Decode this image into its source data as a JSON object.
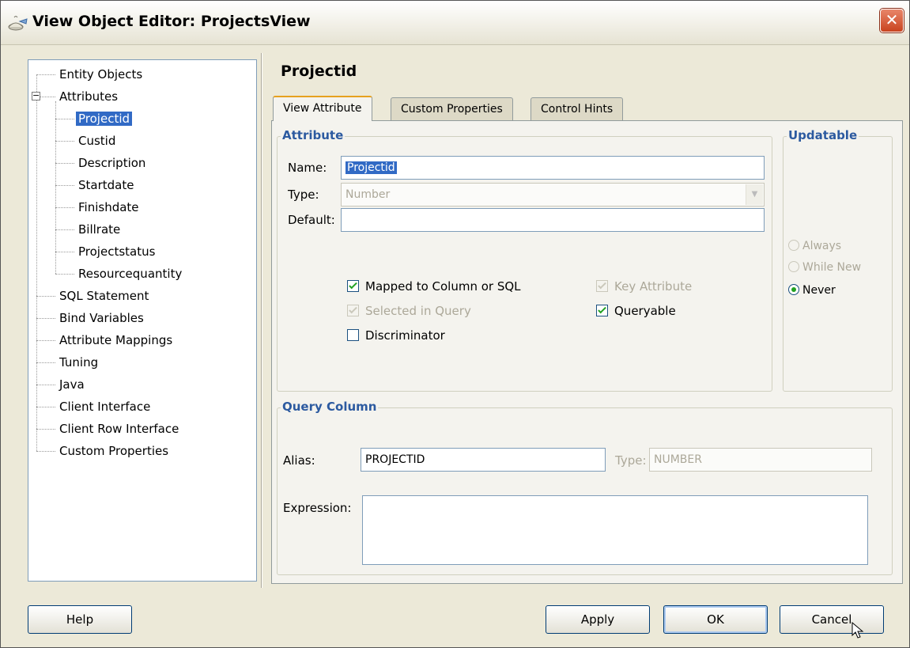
{
  "window": {
    "title": "View Object Editor: ProjectsView",
    "close_glyph": "✕"
  },
  "tree": {
    "items": [
      {
        "label": "Entity Objects",
        "level": 0
      },
      {
        "label": "Attributes",
        "level": 0,
        "expander": "−"
      },
      {
        "label": "Projectid",
        "level": 1,
        "selected": true
      },
      {
        "label": "Custid",
        "level": 1
      },
      {
        "label": "Description",
        "level": 1
      },
      {
        "label": "Startdate",
        "level": 1
      },
      {
        "label": "Finishdate",
        "level": 1
      },
      {
        "label": "Billrate",
        "level": 1
      },
      {
        "label": "Projectstatus",
        "level": 1
      },
      {
        "label": "Resourcequantity",
        "level": 1
      },
      {
        "label": "SQL Statement",
        "level": 0
      },
      {
        "label": "Bind Variables",
        "level": 0
      },
      {
        "label": "Attribute Mappings",
        "level": 0
      },
      {
        "label": "Tuning",
        "level": 0
      },
      {
        "label": "Java",
        "level": 0
      },
      {
        "label": "Client Interface",
        "level": 0
      },
      {
        "label": "Client Row Interface",
        "level": 0
      },
      {
        "label": "Custom Properties",
        "level": 0
      }
    ]
  },
  "page": {
    "title": "Projectid",
    "tabs": [
      {
        "label": "View Attribute",
        "active": true
      },
      {
        "label": "Custom Properties",
        "active": false
      },
      {
        "label": "Control Hints",
        "active": false
      }
    ]
  },
  "attribute": {
    "group_title": "Attribute",
    "name_label": "Name:",
    "name_value": "Projectid",
    "type_label": "Type:",
    "type_value": "Number",
    "default_label": "Default:",
    "default_value": "",
    "checks": {
      "mapped": {
        "label": "Mapped to Column or SQL",
        "checked": true,
        "enabled": true
      },
      "selected_in_query": {
        "label": "Selected in Query",
        "checked": true,
        "enabled": false
      },
      "discriminator": {
        "label": "Discriminator",
        "checked": false,
        "enabled": true
      },
      "key_attribute": {
        "label": "Key Attribute",
        "checked": true,
        "enabled": false
      },
      "queryable": {
        "label": "Queryable",
        "checked": true,
        "enabled": true
      }
    }
  },
  "updatable": {
    "group_title": "Updatable",
    "options": [
      {
        "label": "Always",
        "checked": false,
        "enabled": false
      },
      {
        "label": "While New",
        "checked": false,
        "enabled": false
      },
      {
        "label": "Never",
        "checked": true,
        "enabled": true
      }
    ]
  },
  "query_column": {
    "group_title": "Query Column",
    "alias_label": "Alias:",
    "alias_value": "PROJECTID",
    "type_label": "Type:",
    "type_value": "NUMBER",
    "expression_label": "Expression:",
    "expression_value": ""
  },
  "buttons": {
    "help": "Help",
    "apply": "Apply",
    "ok": "OK",
    "cancel": "Cancel"
  },
  "colors": {
    "accent": "#2c5aa0",
    "selection": "#316ac5",
    "check": "#21a121"
  }
}
